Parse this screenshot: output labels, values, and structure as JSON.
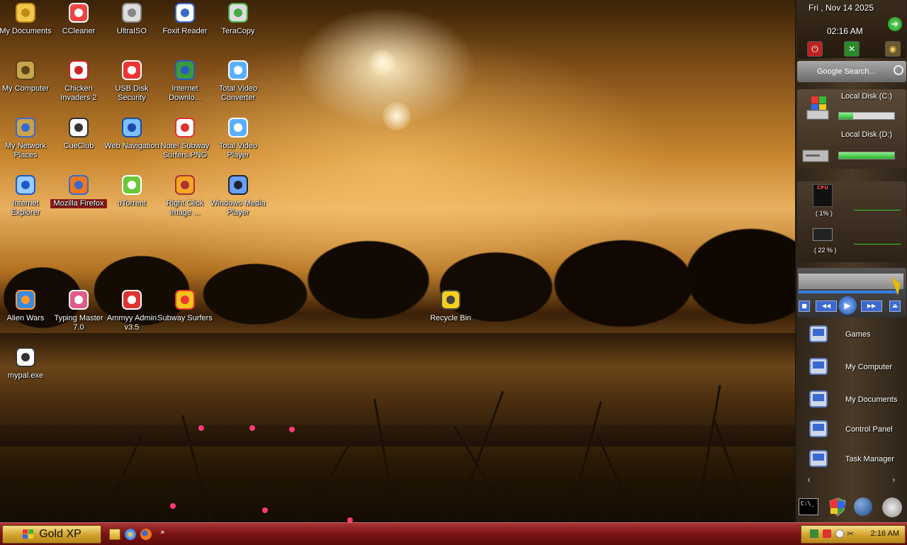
{
  "desktop_icons": [
    {
      "label": "My Documents",
      "icon": "folder-documents-icon",
      "col": 0,
      "row": 0
    },
    {
      "label": "CCleaner",
      "icon": "ccleaner-icon",
      "col": 1,
      "row": 0
    },
    {
      "label": "UltraISO",
      "icon": "disc-icon",
      "col": 2,
      "row": 0
    },
    {
      "label": "Foxit Reader",
      "icon": "foxit-reader-icon",
      "col": 3,
      "row": 0
    },
    {
      "label": "TeraCopy",
      "icon": "teracopy-icon",
      "col": 4,
      "row": 0
    },
    {
      "label": "My Computer",
      "icon": "computer-icon",
      "col": 0,
      "row": 1
    },
    {
      "label": "Chicken Invaders 2",
      "icon": "chicken-invaders-icon",
      "col": 1,
      "row": 1
    },
    {
      "label": "USB Disk Security",
      "icon": "shield-icon",
      "col": 2,
      "row": 1
    },
    {
      "label": "Internet Downlo...",
      "icon": "internet-download-icon",
      "col": 3,
      "row": 1
    },
    {
      "label": "Total Video Converter",
      "icon": "video-converter-icon",
      "col": 4,
      "row": 1
    },
    {
      "label": "My Network Places",
      "icon": "network-places-icon",
      "col": 0,
      "row": 2
    },
    {
      "label": "CueClub",
      "icon": "cueclub-icon",
      "col": 1,
      "row": 2
    },
    {
      "label": "Web Navigation",
      "icon": "globe-icon",
      "col": 2,
      "row": 2
    },
    {
      "label": "Note! Subway Surfers.PNG",
      "icon": "image-file-icon",
      "col": 3,
      "row": 2
    },
    {
      "label": "Total Video Player",
      "icon": "video-player-icon",
      "col": 4,
      "row": 2
    },
    {
      "label": "Internet Explorer",
      "icon": "internet-explorer-icon",
      "col": 0,
      "row": 3
    },
    {
      "label": "Mozilla Firefox",
      "icon": "firefox-icon",
      "col": 1,
      "row": 3,
      "selected": true
    },
    {
      "label": "uTorrent",
      "icon": "utorrent-icon",
      "col": 2,
      "row": 3
    },
    {
      "label": "Right Click Image ...",
      "icon": "right-click-image-icon",
      "col": 3,
      "row": 3
    },
    {
      "label": "Windows Media Player",
      "icon": "media-player-icon",
      "col": 4,
      "row": 3
    },
    {
      "label": "Alien Wars",
      "icon": "alien-wars-icon",
      "col": 0,
      "row": 5
    },
    {
      "label": "Typing Master 7.0",
      "icon": "typing-master-icon",
      "col": 1,
      "row": 5
    },
    {
      "label": "Ammyy Admin v3.5",
      "icon": "ammyy-admin-icon",
      "col": 2,
      "row": 5
    },
    {
      "label": "Subway Surfers",
      "icon": "subway-surfers-icon",
      "col": 3,
      "row": 5
    },
    {
      "label": "Recycle Bin",
      "icon": "recycle-bin-icon",
      "col": 8,
      "row": 5
    },
    {
      "label": "mypal.exe",
      "icon": "mypal-icon",
      "col": 0,
      "row": 6
    }
  ],
  "sidebar": {
    "date": "Fri , Nov 14 2025",
    "time": "02:16 AM",
    "search_placeholder": "Google Search...",
    "disks": [
      {
        "label": "Local Disk (C:)",
        "used": 0.25
      },
      {
        "label": "Local Disk (D:)",
        "used": 1.0
      }
    ],
    "meters": [
      {
        "label": "CPU",
        "value": "( 1% )"
      },
      {
        "label": "RAM",
        "value": "( 22 % )"
      }
    ],
    "launcher": [
      {
        "label": "Games",
        "icon": "games-icon"
      },
      {
        "label": "My Computer",
        "icon": "computer-icon"
      },
      {
        "label": "My Documents",
        "icon": "folder-documents-icon"
      },
      {
        "label": "Control Panel",
        "icon": "control-panel-icon"
      },
      {
        "label": "Task Manager",
        "icon": "task-manager-icon"
      }
    ],
    "cmd_label": "C:\\_"
  },
  "taskbar": {
    "start_label": "Gold XP",
    "overflow": "»",
    "clock": "2:16 AM"
  },
  "colors": {
    "taskbar": "#7a1414",
    "start_gold": "#d4a530",
    "selection": "#8b1a1a"
  }
}
